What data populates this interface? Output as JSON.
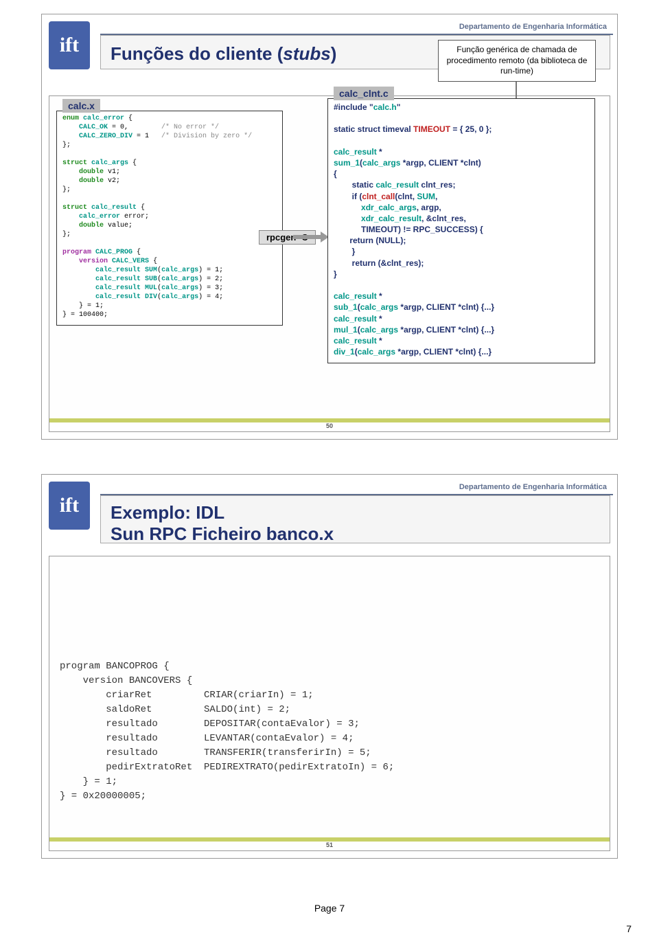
{
  "dept_header": "Departamento de Engenharia Informática",
  "logo_text": "ift",
  "slide1": {
    "title_main": "Funções do cliente (",
    "title_italic": "stubs",
    "title_end": ")",
    "callout": "Função genérica de chamada de procedimento remoto (da biblioteca de run-time)",
    "file_left": "calc.x",
    "file_right": "calc_clnt.c",
    "rpcgen": "rpcgen -C",
    "slide_num": "50",
    "code_left": {
      "l1": "enum calc_error {",
      "l2": "    CALC_OK = 0,        /* No error */",
      "l3": "    CALC_ZERO_DIV = 1   /* Division by zero */",
      "l4": "};",
      "l5": "",
      "l6": "struct calc_args {",
      "l7": "    double v1;",
      "l8": "    double v2;",
      "l9": "};",
      "l10": "",
      "l11": "struct calc_result {",
      "l12": "    calc_error error;",
      "l13": "    double value;",
      "l14": "};",
      "l15": "",
      "l16": "program CALC_PROG {",
      "l17": "    version CALC_VERS {",
      "l18": "        calc_result SUM(calc_args) = 1;",
      "l19": "        calc_result SUB(calc_args) = 2;",
      "l20": "        calc_result MUL(calc_args) = 3;",
      "l21": "        calc_result DIV(calc_args) = 4;",
      "l22": "    } = 1;",
      "l23": "} = 100400;"
    },
    "code_right": {
      "l1": "#include \"calc.h\"",
      "l2": "",
      "l3": "static struct timeval TIMEOUT = { 25, 0 };",
      "l4": "",
      "l5": "calc_result *",
      "l6": "sum_1(calc_args *argp, CLIENT *clnt)",
      "l7": "{",
      "l8": "        static calc_result clnt_res;",
      "l9": "        if (clnt_call(clnt, SUM,",
      "l10": "            xdr_calc_args, argp,",
      "l11": "            xdr_calc_result, &clnt_res,",
      "l12": "            TIMEOUT) != RPC_SUCCESS) {",
      "l13": "       return (NULL);",
      "l14": "        }",
      "l15": "        return (&clnt_res);",
      "l16": "}",
      "l17": "",
      "l18": "calc_result *",
      "l19": "sub_1(calc_args *argp, CLIENT *clnt) {...}",
      "l20": "calc_result *",
      "l21": "mul_1(calc_args *argp, CLIENT *clnt) {...}",
      "l22": "calc_result *",
      "l23": "div_1(calc_args *argp, CLIENT *clnt) {...}"
    }
  },
  "slide2": {
    "title_line1": "Exemplo: IDL",
    "title_line2": "Sun RPC  Ficheiro banco.x",
    "slide_num": "51",
    "code": "program BANCOPROG {\n    version BANCOVERS {\n        criarRet         CRIAR(criarIn) = 1;\n        saldoRet         SALDO(int) = 2;\n        resultado        DEPOSITAR(contaEvalor) = 3;\n        resultado        LEVANTAR(contaEvalor) = 4;\n        resultado        TRANSFERIR(transferirIn) = 5;\n        pedirExtratoRet  PEDIREXTRATO(pedirExtratoIn) = 6;\n    } = 1;\n} = 0x20000005;"
  },
  "page_footer": "Page 7",
  "page_corner": "7"
}
